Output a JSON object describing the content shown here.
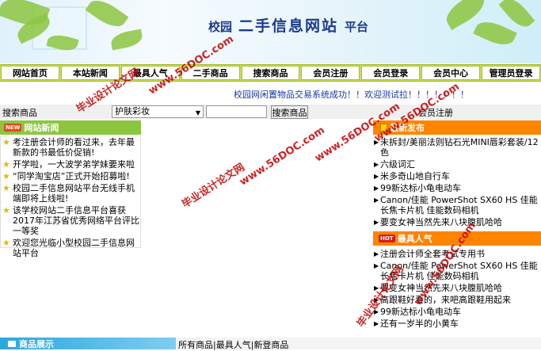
{
  "banner": {
    "prefix": "校园",
    "main": "二手信息网站",
    "suffix": "平台"
  },
  "nav": {
    "items": [
      "网站首页",
      "本站新闻",
      "最具人气",
      "二手商品",
      "搜索商品",
      "会员注册",
      "会员登录",
      "会员中心",
      "管理员登录"
    ]
  },
  "marquee": "校园网闲置物品交易系统成功！！欢迎测试拉！！！！！！！",
  "search": {
    "label": "搜索商品",
    "category": "护肤彩妆",
    "keyword": "",
    "button": "搜索商品",
    "register": "会员注册"
  },
  "news": {
    "title": "网站新闻",
    "badge": "NEW",
    "items": [
      "考注册会计师的看过来，去年最新款的书最低价促销!",
      "开学啦，一大波学弟学妹要来啦",
      "“同学淘宝店”正式开始招募啦!",
      "校园二手信息网站平台无线手机端即将上线啦!",
      "该学校网站二手信息平台喜获2017年江苏省优秀网络平台评比一等奖",
      "欢迎您光临小型校园二手信息网站平台"
    ]
  },
  "release": {
    "title": "最新发布",
    "items": [
      "未拆封/美丽法则钻石光MINI唇彩套装/12色",
      "六级词汇",
      "米多奇山地自行车",
      "99新达标小龟电动车",
      "Canon/佳能 PowerShot SX60 HS 佳能长焦卡片机 佳能数码相机",
      "要变女神当然先来八块腹肌哈哈"
    ]
  },
  "hot": {
    "title": "最具人气",
    "badge": "HOT",
    "items": [
      "注册会计师全套考试专用书",
      "Canon/佳能 PowerShot SX60 HS 佳能长焦卡片机 佳能数码相机",
      "要变女神当然先来八块腹肌哈哈",
      "高跟鞋好看的，来吧高跟鞋用起来",
      "99新达标小龟电动车",
      "还有一岁半的小黄车"
    ]
  },
  "promo": {
    "title": "商品展示",
    "tabs": [
      "所有商品",
      "最具人气",
      "新登商品"
    ]
  },
  "watermark": {
    "text1": "毕业设计论文网",
    "url": "www.56DOC.com"
  },
  "colors": {
    "nav": "#c7dd57",
    "news": "#8cc63f",
    "release": "#ff8400",
    "promo": "#2aa7e0",
    "marquee": "#1636a8"
  }
}
